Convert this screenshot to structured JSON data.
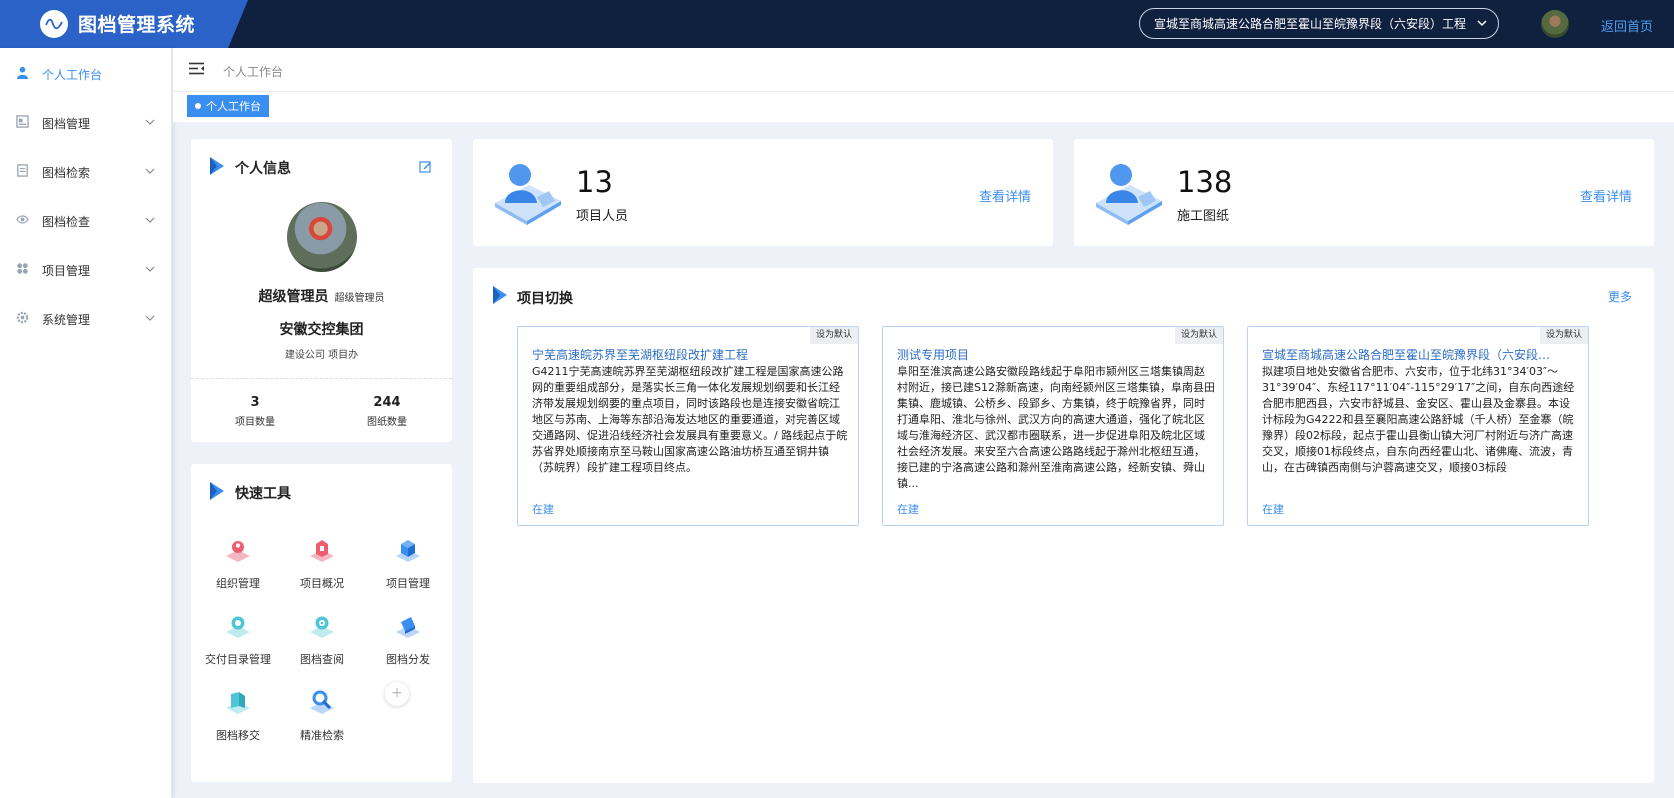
{
  "app": {
    "title": "图档管理系统"
  },
  "header": {
    "project_selector": "宣城至商城高速公路合肥至霍山至皖豫界段（六安段）工程",
    "home_link": "返回首页"
  },
  "sidebar": {
    "items": [
      {
        "label": "个人工作台",
        "icon": "user-icon",
        "active": true
      },
      {
        "label": "图档管理",
        "icon": "archive-icon",
        "active": false
      },
      {
        "label": "图档检索",
        "icon": "document-search-icon",
        "active": false
      },
      {
        "label": "图档检查",
        "icon": "eye-icon",
        "active": false
      },
      {
        "label": "项目管理",
        "icon": "grid-icon",
        "active": false
      },
      {
        "label": "系统管理",
        "icon": "gear-icon",
        "active": false
      }
    ]
  },
  "breadcrumb": {
    "current": "个人工作台"
  },
  "tabs": {
    "active": "个人工作台"
  },
  "profile": {
    "title": "个人信息",
    "name": "超级管理员",
    "role": "超级管理员",
    "organization": "安徽交控集团",
    "department": "建设公司 项目办",
    "stats": [
      {
        "value": "3",
        "label": "项目数量"
      },
      {
        "value": "244",
        "label": "图纸数量"
      }
    ]
  },
  "quick_tools": {
    "title": "快速工具",
    "items": [
      {
        "label": "组织管理",
        "icon": "organization-icon"
      },
      {
        "label": "项目概况",
        "icon": "project-overview-icon"
      },
      {
        "label": "项目管理",
        "icon": "project-manage-icon"
      },
      {
        "label": "交付目录管理",
        "icon": "delivery-catalog-icon"
      },
      {
        "label": "图档查阅",
        "icon": "archive-view-icon"
      },
      {
        "label": "图档分发",
        "icon": "archive-distribute-icon"
      },
      {
        "label": "图档移交",
        "icon": "archive-transfer-icon"
      },
      {
        "label": "精准检索",
        "icon": "precise-search-icon"
      }
    ]
  },
  "stat_cards": [
    {
      "value": "13",
      "caption": "项目人员",
      "link": "查看详情"
    },
    {
      "value": "138",
      "caption": "施工图纸",
      "link": "查看详情"
    }
  ],
  "project_switch": {
    "title": "项目切换",
    "more": "更多",
    "projects": [
      {
        "default_label": "设为默认",
        "name": "宁芜高速皖苏界至芜湖枢纽段改扩建工程",
        "description": "G4211宁芜高速皖苏界至芜湖枢纽段改扩建工程是国家高速公路网的重要组成部分，是落实长三角一体化发展规划纲要和长江经济带发展规划纲要的重点项目，同时该路段也是连接安徽省皖江地区与苏南、上海等东部沿海发达地区的重要通道，对完善区域交通路网、促进沿线经济社会发展具有重要意义。/ 路线起点于皖苏省界处顺接南京至马鞍山国家高速公路油坊桥互通至铜井镇（苏皖界）段扩建工程项目终点。",
        "status": "在建"
      },
      {
        "default_label": "设为默认",
        "name": "测试专用项目",
        "description": "阜阳至淮滨高速公路安徽段路线起于阜阳市颍州区三塔集镇周赵村附近，接已建S12滁新高速，向南经颍州区三塔集镇，阜南县田集镇、鹿城镇、公桥乡、段郢乡、方集镇，终于皖豫省界，同时打通阜阳、淮北与徐州、武汉方向的高速大通道，强化了皖北区域与淮海经济区、武汉都市圈联系，进一步促进阜阳及皖北区域社会经济发展。来安至六合高速公路路线起于滁州北枢纽互通，接已建的宁洛高速公路和滁州至淮南高速公路，经新安镇、舜山镇...",
        "status": "在建"
      },
      {
        "default_label": "设为默认",
        "name": "宣城至商城高速公路合肥至霍山至皖豫界段（六安段）工程",
        "description": "拟建项目地处安徽省合肥市、六安市，位于北纬31°34′03″～31°39′04″、东经117°11′04″-115°29′17″之间，自东向西途经合肥市肥西县，六安市舒城县、金安区、霍山县及金寨县。本设计标段为G4222和县至襄阳高速公路舒城（千人桥）至金寨（皖豫界）段02标段，起点于霍山县衡山镇大河厂村附近与济广高速交叉，顺接01标段终点，自东向西经霍山北、诸佛庵、流波，青山，在古碑镇西南侧与沪蓉高速交叉，顺接03标段",
        "status": "在建"
      }
    ]
  },
  "colors": {
    "header_bg": "#10213f",
    "brand_bg": "#2b62c7",
    "accent": "#3a8ef0",
    "page_bg": "#eef2f8"
  }
}
